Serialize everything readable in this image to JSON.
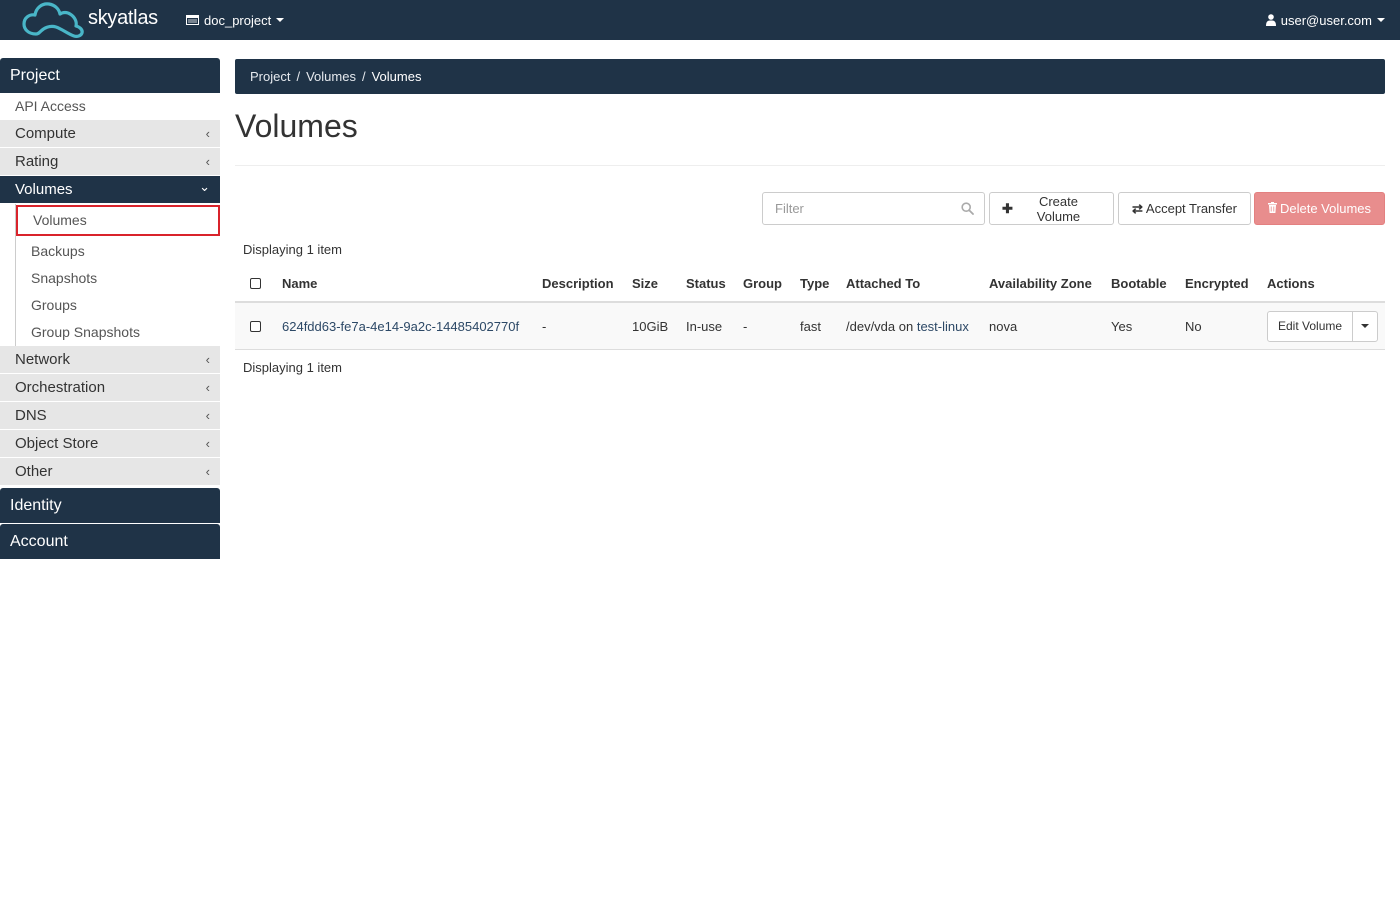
{
  "navbar": {
    "brand": "skyatlas",
    "project": "doc_project",
    "user": "user@user.com"
  },
  "sidebar": {
    "project_label": "Project",
    "api_access": "API Access",
    "panels": {
      "compute": "Compute",
      "rating": "Rating",
      "volumes": "Volumes",
      "network": "Network",
      "orchestration": "Orchestration",
      "dns": "DNS",
      "object_store": "Object Store",
      "other": "Other"
    },
    "volumes_items": [
      "Volumes",
      "Backups",
      "Snapshots",
      "Groups",
      "Group Snapshots"
    ],
    "identity_label": "Identity",
    "account_label": "Account",
    "chevron_collapsed": "‹",
    "chevron_expanded": "⌄"
  },
  "breadcrumb": [
    "Project",
    "Volumes",
    "Volumes"
  ],
  "breadcrumb_separator": "/",
  "page_title": "Volumes",
  "toolbar": {
    "filter_placeholder": "Filter",
    "create_label": "Create Volume",
    "accept_label": "Accept Transfer",
    "delete_label": "Delete Volumes",
    "plus_glyph": "✚",
    "transfer_glyph": "⇄"
  },
  "table": {
    "count_text": "Displaying 1 item",
    "headers": [
      "Name",
      "Description",
      "Size",
      "Status",
      "Group",
      "Type",
      "Attached To",
      "Availability Zone",
      "Bootable",
      "Encrypted",
      "Actions"
    ],
    "rows": [
      {
        "name": "624fdd63-fe7a-4e14-9a2c-14485402770f",
        "description": "-",
        "size": "10GiB",
        "status": "In-use",
        "group": "-",
        "type": "fast",
        "attached_prefix": "/dev/vda on",
        "attached_instance": "test-linux",
        "availability_zone": "nova",
        "bootable": "Yes",
        "encrypted": "No",
        "action_label": "Edit Volume"
      }
    ]
  },
  "colors": {
    "navbar": "#1f3347",
    "danger": "#e88d8d",
    "highlight": "#d9232b",
    "link": "#2c4866"
  }
}
